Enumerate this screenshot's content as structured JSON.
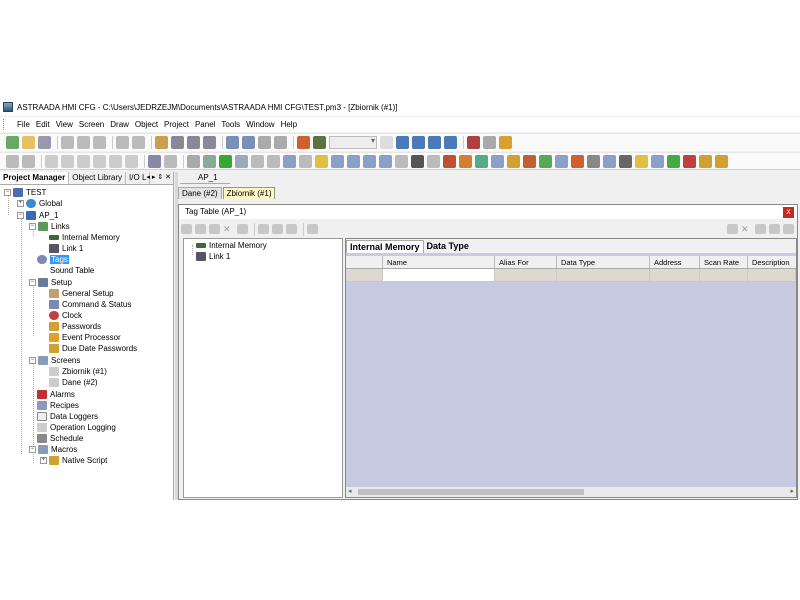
{
  "window": {
    "title": "ASTRAADA HMI CFG - C:\\Users\\JEDRZEJM\\Documents\\ASTRAADA HMI CFG\\TEST.pm3 - [Zbiornik (#1)]"
  },
  "menu": [
    "File",
    "Edit",
    "View",
    "Screen",
    "Draw",
    "Object",
    "Project",
    "Panel",
    "Tools",
    "Window",
    "Help"
  ],
  "left_panel": {
    "tabs": [
      "Project Manager",
      "Object Library",
      "I/O L"
    ],
    "controls": "◂ ▸ ⇕ ✕",
    "tree": [
      {
        "label": "TEST",
        "level": 0
      },
      {
        "label": "Global",
        "level": 1
      },
      {
        "label": "AP_1",
        "level": 1
      },
      {
        "label": "Links",
        "level": 2
      },
      {
        "label": "Internal Memory",
        "level": 3
      },
      {
        "label": "Link 1",
        "level": 3
      },
      {
        "label": "Tags",
        "level": 2,
        "selected": true
      },
      {
        "label": "Sound Table",
        "level": 2
      },
      {
        "label": "Setup",
        "level": 2
      },
      {
        "label": "General Setup",
        "level": 3
      },
      {
        "label": "Command & Status",
        "level": 3
      },
      {
        "label": "Clock",
        "level": 3
      },
      {
        "label": "Passwords",
        "level": 3
      },
      {
        "label": "Event Processor",
        "level": 3
      },
      {
        "label": "Due Date Passwords",
        "level": 3
      },
      {
        "label": "Screens",
        "level": 2
      },
      {
        "label": "Zbiornik (#1)",
        "level": 3
      },
      {
        "label": "Dane (#2)",
        "level": 3
      },
      {
        "label": "Alarms",
        "level": 2
      },
      {
        "label": "Recipes",
        "level": 2
      },
      {
        "label": "Data Loggers",
        "level": 2
      },
      {
        "label": "Operation Logging",
        "level": 2
      },
      {
        "label": "Schedule",
        "level": 2
      },
      {
        "label": "Macros",
        "level": 2
      },
      {
        "label": "Native Script",
        "level": 3
      }
    ]
  },
  "doc_tabs": {
    "project": "AP_1",
    "screens": [
      "Dane (#2)",
      "Zbiornik (#1)"
    ]
  },
  "tag_table": {
    "title": "Tag Table (AP_1)",
    "close": "x",
    "tree": [
      "Internal Memory",
      "Link 1"
    ],
    "tabs": [
      "Internal Memory",
      "Data Type"
    ],
    "columns": [
      "Name",
      "Alias For",
      "Data Type",
      "Address",
      "Scan Rate",
      "Description"
    ]
  }
}
